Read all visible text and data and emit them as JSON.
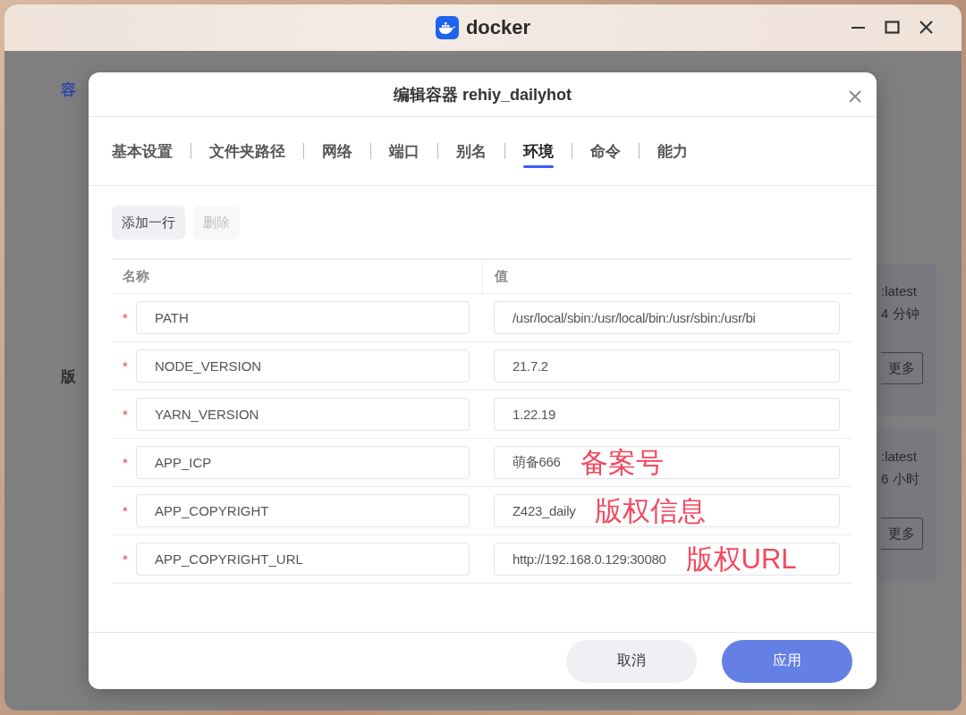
{
  "window": {
    "title": "docker"
  },
  "sidebar": {
    "items": [
      {
        "label": "容",
        "selected": true
      },
      {
        "label": "版",
        "selected": false
      }
    ]
  },
  "cards": [
    {
      "tag": ":latest",
      "time": "4 分钟",
      "button": "更多"
    },
    {
      "tag": ":latest",
      "time": "6 小时",
      "button": "更多"
    }
  ],
  "dialog": {
    "title": "编辑容器 rehiy_dailyhot",
    "tabs": [
      {
        "label": "基本设置",
        "selected": false
      },
      {
        "label": "文件夹路径",
        "selected": false
      },
      {
        "label": "网络",
        "selected": false
      },
      {
        "label": "端口",
        "selected": false
      },
      {
        "label": "别名",
        "selected": false
      },
      {
        "label": "环境",
        "selected": true
      },
      {
        "label": "命令",
        "selected": false
      },
      {
        "label": "能力",
        "selected": false
      }
    ],
    "toolbar": [
      {
        "label": "添加一行",
        "disabled": false
      },
      {
        "label": "删除",
        "disabled": true
      }
    ],
    "table": {
      "columns": [
        "名称",
        "值"
      ],
      "rows": [
        {
          "required_mark": "*",
          "name": "PATH",
          "value": "/usr/local/sbin:/usr/local/bin:/usr/sbin:/usr/bi"
        },
        {
          "required_mark": "*",
          "name": "NODE_VERSION",
          "value": "21.7.2"
        },
        {
          "required_mark": "*",
          "name": "YARN_VERSION",
          "value": "1.22.19"
        },
        {
          "required_mark": "*",
          "name": "APP_ICP",
          "value": "萌备666",
          "annotation": "备案号"
        },
        {
          "required_mark": "*",
          "name": "APP_COPYRIGHT",
          "value": "Z423_daily",
          "annotation": "版权信息"
        },
        {
          "required_mark": "*",
          "name": "APP_COPYRIGHT_URL",
          "value": "http://192.168.0.129:30080",
          "annotation": "版权URL"
        }
      ]
    },
    "buttons": [
      {
        "label": "取消",
        "kind": "secondary"
      },
      {
        "label": "应用",
        "kind": "primary"
      }
    ]
  }
}
